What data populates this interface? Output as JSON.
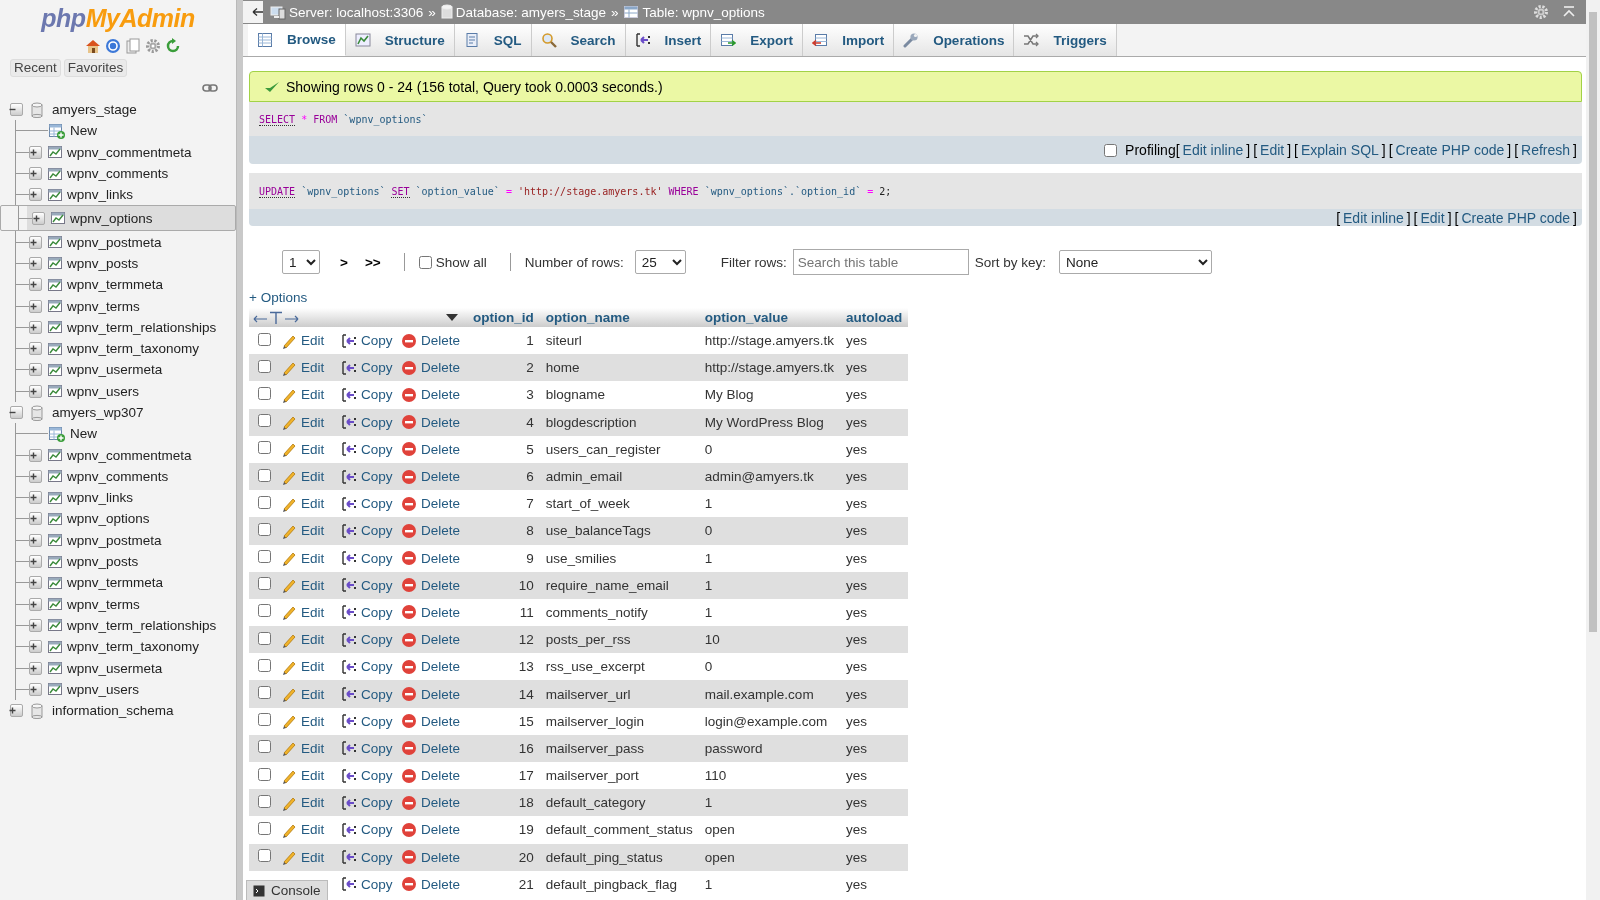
{
  "navigation": {
    "logo": [
      "php",
      "MyAdmin"
    ],
    "recent": "Recent",
    "favorites": "Favorites",
    "tree": [
      {
        "name": "amyers_stage",
        "expanded": true,
        "selected": false,
        "children": [
          {
            "name": "New",
            "kind": "new",
            "selected": false
          },
          {
            "name": "wpnv_commentmeta",
            "kind": "table",
            "expanded": false,
            "selected": false
          },
          {
            "name": "wpnv_comments",
            "kind": "table",
            "expanded": false,
            "selected": false
          },
          {
            "name": "wpnv_links",
            "kind": "table",
            "expanded": false,
            "selected": false
          },
          {
            "name": "wpnv_options",
            "kind": "table",
            "expanded": false,
            "selected": true
          },
          {
            "name": "wpnv_postmeta",
            "kind": "table",
            "expanded": false,
            "selected": false
          },
          {
            "name": "wpnv_posts",
            "kind": "table",
            "expanded": false,
            "selected": false
          },
          {
            "name": "wpnv_termmeta",
            "kind": "table",
            "expanded": false,
            "selected": false
          },
          {
            "name": "wpnv_terms",
            "kind": "table",
            "expanded": false,
            "selected": false
          },
          {
            "name": "wpnv_term_relationships",
            "kind": "table",
            "expanded": false,
            "selected": false
          },
          {
            "name": "wpnv_term_taxonomy",
            "kind": "table",
            "expanded": false,
            "selected": false
          },
          {
            "name": "wpnv_usermeta",
            "kind": "table",
            "expanded": false,
            "selected": false
          },
          {
            "name": "wpnv_users",
            "kind": "table",
            "expanded": false,
            "selected": false
          }
        ]
      },
      {
        "name": "amyers_wp307",
        "expanded": true,
        "selected": false,
        "children": [
          {
            "name": "New",
            "kind": "new",
            "selected": false
          },
          {
            "name": "wpnv_commentmeta",
            "kind": "table",
            "expanded": false,
            "selected": false
          },
          {
            "name": "wpnv_comments",
            "kind": "table",
            "expanded": false,
            "selected": false
          },
          {
            "name": "wpnv_links",
            "kind": "table",
            "expanded": false,
            "selected": false
          },
          {
            "name": "wpnv_options",
            "kind": "table",
            "expanded": false,
            "selected": false
          },
          {
            "name": "wpnv_postmeta",
            "kind": "table",
            "expanded": false,
            "selected": false
          },
          {
            "name": "wpnv_posts",
            "kind": "table",
            "expanded": false,
            "selected": false
          },
          {
            "name": "wpnv_termmeta",
            "kind": "table",
            "expanded": false,
            "selected": false
          },
          {
            "name": "wpnv_terms",
            "kind": "table",
            "expanded": false,
            "selected": false
          },
          {
            "name": "wpnv_term_relationships",
            "kind": "table",
            "expanded": false,
            "selected": false
          },
          {
            "name": "wpnv_term_taxonomy",
            "kind": "table",
            "expanded": false,
            "selected": false
          },
          {
            "name": "wpnv_usermeta",
            "kind": "table",
            "expanded": false,
            "selected": false
          },
          {
            "name": "wpnv_users",
            "kind": "table",
            "expanded": false,
            "selected": false
          }
        ]
      },
      {
        "name": "information_schema",
        "expanded": false,
        "selected": false
      }
    ]
  },
  "breadcrumb": {
    "separator": "»",
    "items": [
      {
        "kind": "server",
        "label": "Server: localhost:3306"
      },
      {
        "kind": "database",
        "label": "Database: amyers_stage"
      },
      {
        "kind": "table",
        "label": "Table: wpnv_options"
      }
    ]
  },
  "tabs": [
    {
      "kind": "browse",
      "label": "Browse",
      "selected": true
    },
    {
      "kind": "structure",
      "label": "Structure",
      "selected": false
    },
    {
      "kind": "sql",
      "label": "SQL",
      "selected": false
    },
    {
      "kind": "search",
      "label": "Search",
      "selected": false
    },
    {
      "kind": "insert",
      "label": "Insert",
      "selected": false
    },
    {
      "kind": "export",
      "label": "Export",
      "selected": false
    },
    {
      "kind": "import",
      "label": "Import",
      "selected": false
    },
    {
      "kind": "operations",
      "label": "Operations",
      "selected": false
    },
    {
      "kind": "triggers",
      "label": "Triggers",
      "selected": false
    }
  ],
  "message": "Showing rows 0 - 24 (156 total, Query took 0.0003 seconds.)",
  "queries": [
    {
      "sql": [
        {
          "t": "SELECT",
          "kind": "keyword"
        },
        {
          "t": "*",
          "kind": "operator"
        },
        {
          "t": "FROM",
          "kind": "keyword2"
        },
        {
          "t": "`wpnv_options`",
          "kind": "identifier"
        }
      ],
      "profiling": {
        "label": "Profiling",
        "checked": false
      },
      "links": [
        {
          "pre": "[",
          "label": "Edit inline",
          "post": "]"
        },
        {
          "pre": "[",
          "label": "Edit",
          "post": "]"
        },
        {
          "pre": "[",
          "label": "Explain SQL",
          "post": "]"
        },
        {
          "pre": "[",
          "label": "Create PHP code",
          "post": "]"
        },
        {
          "pre": "[",
          "label": "Refresh",
          "post": "]"
        }
      ]
    },
    {
      "sql": [
        {
          "t": "UPDATE",
          "kind": "keyword"
        },
        {
          "t": "`wpnv_options`",
          "kind": "identifier"
        },
        {
          "t": "SET",
          "kind": "keyword"
        },
        {
          "t": "`option_value`",
          "kind": "identifier"
        },
        {
          "t": "=",
          "kind": "operator"
        },
        {
          "t": "'http://stage.amyers.tk'",
          "kind": "string"
        },
        {
          "t": "WHERE",
          "kind": "keyword2"
        },
        {
          "t": "`wpnv_options`.`option_id`",
          "kind": "identifier"
        },
        {
          "t": "=",
          "kind": "operator"
        },
        {
          "t": "2;",
          "kind": "plain"
        }
      ],
      "links": [
        {
          "pre": "[",
          "label": "Edit inline",
          "post": "]"
        },
        {
          "pre": "[",
          "label": "Edit",
          "post": "]"
        },
        {
          "pre": "[",
          "label": "Create PHP code",
          "post": "]"
        }
      ]
    }
  ],
  "pager": {
    "page": "1",
    "next": ">",
    "last": ">>",
    "show_all": {
      "label": "Show all",
      "checked": false
    },
    "rows_label": "Number of rows:",
    "rows": "25",
    "filter_label": "Filter rows:",
    "filter_placeholder": "Search this table",
    "sort_label": "Sort by key:",
    "sort": "None"
  },
  "table": {
    "options_link": "+ Options",
    "columns": [
      "option_id",
      "option_name",
      "option_value",
      "autoload"
    ],
    "rows": [
      {
        "selected": false,
        "actions": {
          "edit": "Edit",
          "copy": "Copy",
          "delete": "Delete"
        },
        "cells": [
          "1",
          "siteurl",
          "http://stage.amyers.tk",
          "yes"
        ]
      },
      {
        "selected": false,
        "actions": {
          "edit": "Edit",
          "copy": "Copy",
          "delete": "Delete"
        },
        "cells": [
          "2",
          "home",
          "http://stage.amyers.tk",
          "yes"
        ]
      },
      {
        "selected": false,
        "actions": {
          "edit": "Edit",
          "copy": "Copy",
          "delete": "Delete"
        },
        "cells": [
          "3",
          "blogname",
          "My Blog",
          "yes"
        ]
      },
      {
        "selected": false,
        "actions": {
          "edit": "Edit",
          "copy": "Copy",
          "delete": "Delete"
        },
        "cells": [
          "4",
          "blogdescription",
          "My WordPress Blog",
          "yes"
        ]
      },
      {
        "selected": false,
        "actions": {
          "edit": "Edit",
          "copy": "Copy",
          "delete": "Delete"
        },
        "cells": [
          "5",
          "users_can_register",
          "0",
          "yes"
        ]
      },
      {
        "selected": false,
        "actions": {
          "edit": "Edit",
          "copy": "Copy",
          "delete": "Delete"
        },
        "cells": [
          "6",
          "admin_email",
          "admin@amyers.tk",
          "yes"
        ]
      },
      {
        "selected": false,
        "actions": {
          "edit": "Edit",
          "copy": "Copy",
          "delete": "Delete"
        },
        "cells": [
          "7",
          "start_of_week",
          "1",
          "yes"
        ]
      },
      {
        "selected": false,
        "actions": {
          "edit": "Edit",
          "copy": "Copy",
          "delete": "Delete"
        },
        "cells": [
          "8",
          "use_balanceTags",
          "0",
          "yes"
        ]
      },
      {
        "selected": false,
        "actions": {
          "edit": "Edit",
          "copy": "Copy",
          "delete": "Delete"
        },
        "cells": [
          "9",
          "use_smilies",
          "1",
          "yes"
        ]
      },
      {
        "selected": false,
        "actions": {
          "edit": "Edit",
          "copy": "Copy",
          "delete": "Delete"
        },
        "cells": [
          "10",
          "require_name_email",
          "1",
          "yes"
        ]
      },
      {
        "selected": false,
        "actions": {
          "edit": "Edit",
          "copy": "Copy",
          "delete": "Delete"
        },
        "cells": [
          "11",
          "comments_notify",
          "1",
          "yes"
        ]
      },
      {
        "selected": false,
        "actions": {
          "edit": "Edit",
          "copy": "Copy",
          "delete": "Delete"
        },
        "cells": [
          "12",
          "posts_per_rss",
          "10",
          "yes"
        ]
      },
      {
        "selected": false,
        "actions": {
          "edit": "Edit",
          "copy": "Copy",
          "delete": "Delete"
        },
        "cells": [
          "13",
          "rss_use_excerpt",
          "0",
          "yes"
        ]
      },
      {
        "selected": false,
        "actions": {
          "edit": "Edit",
          "copy": "Copy",
          "delete": "Delete"
        },
        "cells": [
          "14",
          "mailserver_url",
          "mail.example.com",
          "yes"
        ]
      },
      {
        "selected": false,
        "actions": {
          "edit": "Edit",
          "copy": "Copy",
          "delete": "Delete"
        },
        "cells": [
          "15",
          "mailserver_login",
          "login@example.com",
          "yes"
        ]
      },
      {
        "selected": false,
        "actions": {
          "edit": "Edit",
          "copy": "Copy",
          "delete": "Delete"
        },
        "cells": [
          "16",
          "mailserver_pass",
          "password",
          "yes"
        ]
      },
      {
        "selected": false,
        "actions": {
          "edit": "Edit",
          "copy": "Copy",
          "delete": "Delete"
        },
        "cells": [
          "17",
          "mailserver_port",
          "110",
          "yes"
        ]
      },
      {
        "selected": false,
        "actions": {
          "edit": "Edit",
          "copy": "Copy",
          "delete": "Delete"
        },
        "cells": [
          "18",
          "default_category",
          "1",
          "yes"
        ]
      },
      {
        "selected": false,
        "actions": {
          "edit": "Edit",
          "copy": "Copy",
          "delete": "Delete"
        },
        "cells": [
          "19",
          "default_comment_status",
          "open",
          "yes"
        ]
      },
      {
        "selected": false,
        "actions": {
          "edit": "Edit",
          "copy": "Copy",
          "delete": "Delete"
        },
        "cells": [
          "20",
          "default_ping_status",
          "open",
          "yes"
        ]
      },
      {
        "actions": {
          "copy": "Copy",
          "delete": "Delete"
        },
        "cells": [
          "21",
          "default_pingback_flag",
          "1",
          "yes"
        ]
      }
    ]
  },
  "console": "Console"
}
